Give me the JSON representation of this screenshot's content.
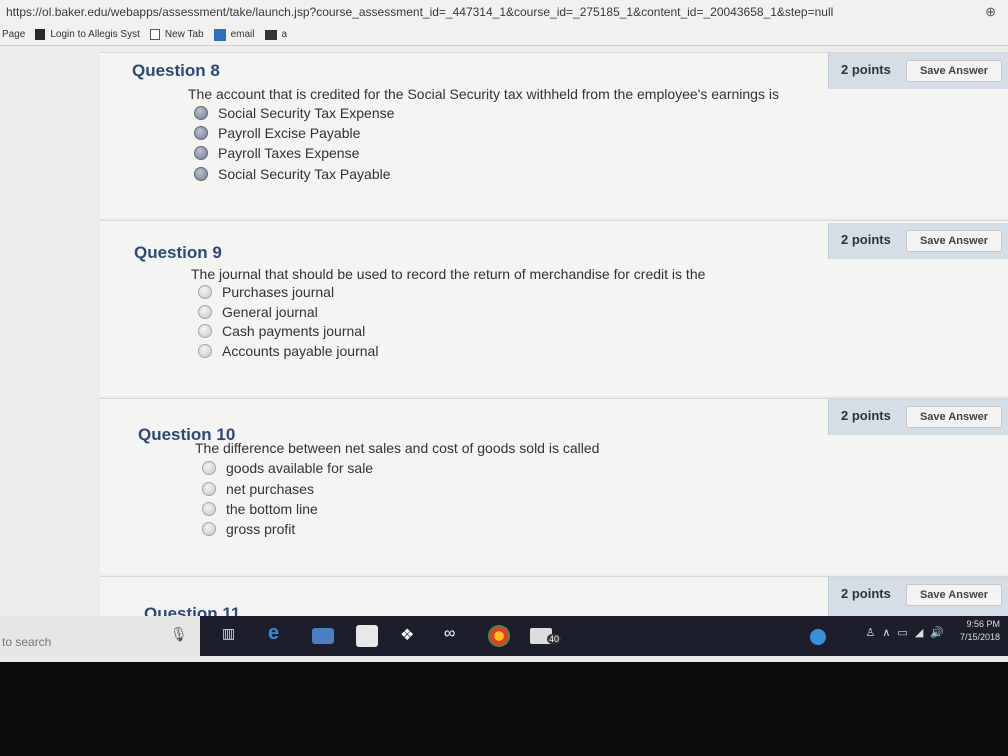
{
  "browser": {
    "url": "https://ol.baker.edu/webapps/assessment/take/launch.jsp?course_assessment_id=_447314_1&course_id=_275185_1&content_id=_20043658_1&step=null",
    "bookmarks": [
      "Page",
      "Login to Allegis Syst",
      "New Tab",
      "email",
      "a"
    ]
  },
  "questions": [
    {
      "title": "Question 8",
      "text": "The account that is credited for the Social Security tax withheld from the employee's earnings is",
      "points": "2 points",
      "save_label": "Save Answer",
      "answers": [
        "Social Security Tax Expense",
        "Payroll Excise Payable",
        "Payroll Taxes Expense",
        "Social Security Tax Payable"
      ]
    },
    {
      "title": "Question 9",
      "text": "The journal that should be used to record the return of merchandise for credit is the",
      "points": "2 points",
      "save_label": "Save Answer",
      "answers": [
        "Purchases journal",
        "General journal",
        "Cash payments journal",
        "Accounts payable journal"
      ]
    },
    {
      "title": "Question 10",
      "text": "The difference between net sales and cost of goods sold is called",
      "points": "2 points",
      "save_label": "Save Answer",
      "answers": [
        "goods available for sale",
        "net purchases",
        "the bottom line",
        "gross profit"
      ]
    },
    {
      "title": "Question 11",
      "points": "2 points",
      "save_label": "Save Answer"
    }
  ],
  "taskbar": {
    "search_placeholder": "to search",
    "mail_badge": "40",
    "time": "9:56 PM",
    "date": "7/15/2018"
  },
  "colors": {
    "question_title": "#2b4a7a",
    "points_panel": "#d5dde6",
    "taskbar": "#1c1f2b"
  }
}
